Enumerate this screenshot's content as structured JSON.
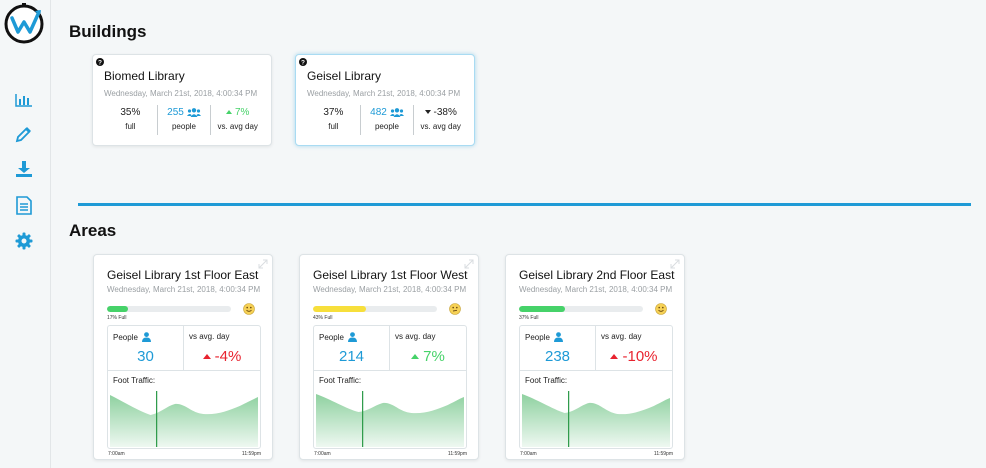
{
  "sidebar": {
    "logo_icon": "waitz-logo-icon",
    "items": [
      {
        "icon": "bar-chart-icon",
        "name": "nav-dashboard"
      },
      {
        "icon": "dropper-icon",
        "name": "nav-tool"
      },
      {
        "icon": "download-icon",
        "name": "nav-download"
      },
      {
        "icon": "document-icon",
        "name": "nav-report"
      },
      {
        "icon": "gear-icon",
        "name": "nav-settings"
      }
    ],
    "accent": "#1e9ad6"
  },
  "buildings": {
    "title": "Buildings",
    "cards": [
      {
        "name": "Biomed Library",
        "timestamp": "Wednesday, March 21st, 2018, 4:00:34 PM",
        "full_value": "35%",
        "full_label": "full",
        "people_value": "255",
        "people_label": "people",
        "vs_value": "7%",
        "vs_direction": "up",
        "vs_label": "vs. avg day"
      },
      {
        "name": "Geisel Library",
        "timestamp": "Wednesday, March 21st, 2018, 4:00:34 PM",
        "full_value": "37%",
        "full_label": "full",
        "people_value": "482",
        "people_label": "people",
        "vs_value": "-38%",
        "vs_direction": "down",
        "vs_label": "vs. avg day"
      }
    ]
  },
  "areas": {
    "title": "Areas",
    "cards": [
      {
        "name": "Geisel Library 1st Floor East",
        "timestamp": "Wednesday, March 21st, 2018, 4:00:34 PM",
        "fill": 0.17,
        "fill_color": "#46d269",
        "fill_label": "17% Full",
        "people_label": "People",
        "people_value": "30",
        "vs_label": "vs avg. day",
        "vs_value": "-4%",
        "vs_direction": "up",
        "vs_color": "red",
        "traffic_label": "Foot Traffic:",
        "time_start": "7:00am",
        "time_end": "11:59pm",
        "face": "smile"
      },
      {
        "name": "Geisel Library 1st Floor West",
        "timestamp": "Wednesday, March 21st, 2018, 4:00:34 PM",
        "fill": 0.43,
        "fill_color": "#f7df3b",
        "fill_label": "43% Full",
        "people_label": "People",
        "people_value": "214",
        "vs_label": "vs avg. day",
        "vs_value": "7%",
        "vs_direction": "up",
        "vs_color": "green",
        "traffic_label": "Foot Traffic:",
        "time_start": "7:00am",
        "time_end": "11:59pm",
        "face": "neutral"
      },
      {
        "name": "Geisel Library 2nd Floor East",
        "timestamp": "Wednesday, March 21st, 2018, 4:00:34 PM",
        "fill": 0.37,
        "fill_color": "#46d269",
        "fill_label": "37% Full",
        "people_label": "People",
        "people_value": "238",
        "vs_label": "vs avg. day",
        "vs_value": "-10%",
        "vs_direction": "up",
        "vs_color": "red",
        "traffic_label": "Foot Traffic:",
        "time_start": "7:00am",
        "time_end": "11:59pm",
        "face": "smile"
      }
    ]
  }
}
